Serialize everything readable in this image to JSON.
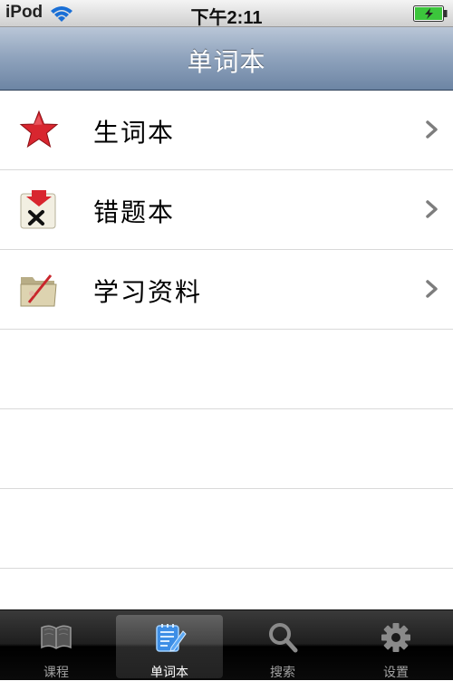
{
  "status_bar": {
    "carrier": "iPod",
    "time": "下午2:11"
  },
  "nav_bar": {
    "title": "单词本"
  },
  "list": {
    "items": [
      {
        "label": "生词本",
        "icon": "star-icon"
      },
      {
        "label": "错题本",
        "icon": "wrong-mark-icon"
      },
      {
        "label": "学习资料",
        "icon": "folder-icon"
      }
    ],
    "empty_rows": 3
  },
  "tab_bar": {
    "tabs": [
      {
        "label": "课程",
        "icon": "book-icon",
        "selected": false
      },
      {
        "label": "单词本",
        "icon": "notepad-icon",
        "selected": true
      },
      {
        "label": "搜索",
        "icon": "search-icon",
        "selected": false
      },
      {
        "label": "设置",
        "icon": "gear-icon",
        "selected": false
      }
    ]
  },
  "colors": {
    "nav_bar": "#7f95b2",
    "tab_selected_icon": "#3d8ee6",
    "battery": "#3cc63c"
  }
}
